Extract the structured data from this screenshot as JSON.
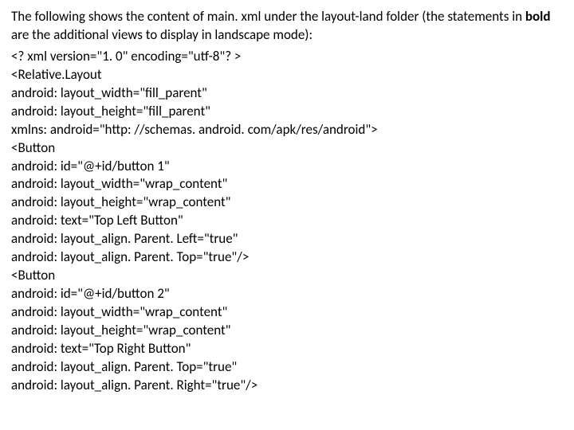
{
  "intro_part1": "The following shows the content of main. xml under the layout-land folder (the statements in ",
  "intro_bold": "bold ",
  "intro_part2": "are the additional views to display in landscape mode):",
  "code_lines": [
    "<? xml version=\"1. 0\" encoding=\"utf-8\"? >",
    "<Relative.Layout",
    "android: layout_width=\"fill_parent\"",
    "android: layout_height=\"fill_parent\"",
    "xmlns: android=\"http: //schemas. android. com/apk/res/android\">",
    "<Button",
    "android: id=\"@+id/button 1\"",
    "android: layout_width=\"wrap_content\"",
    "android: layout_height=\"wrap_content\"",
    "android: text=\"Top Left Button\"",
    "android: layout_align. Parent. Left=\"true\"",
    "android: layout_align. Parent. Top=\"true\"/>",
    "<Button",
    "android: id=\"@+id/button 2\"",
    "android: layout_width=\"wrap_content\"",
    "android: layout_height=\"wrap_content\"",
    "android: text=\"Top Right Button\"",
    "android: layout_align. Parent. Top=\"true\"",
    "android: layout_align. Parent. Right=\"true\"/>"
  ]
}
